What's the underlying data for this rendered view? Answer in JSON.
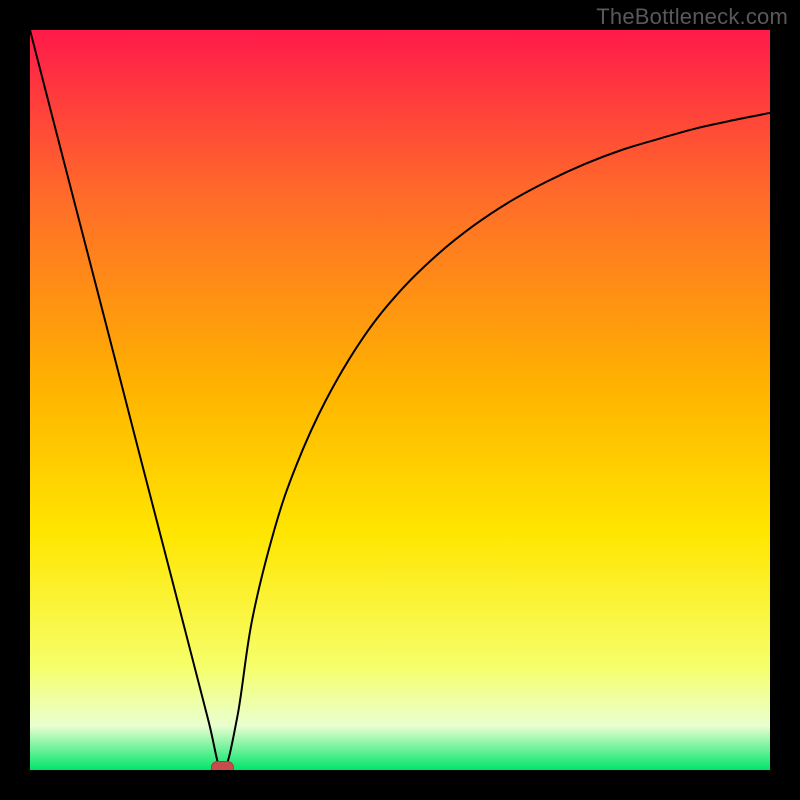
{
  "watermark": "TheBottleneck.com",
  "colors": {
    "frame": "#000000",
    "gradient_top": "#ff1a4a",
    "gradient_mid1": "#ff6a2a",
    "gradient_mid2": "#ffb200",
    "gradient_mid3": "#ffe600",
    "gradient_mid4": "#f6ff6a",
    "gradient_bottom_band": "#e9ffd0",
    "gradient_bottom": "#00e56a",
    "curve": "#000000",
    "marker_fill": "#c94c4c",
    "marker_stroke": "#a63c3c"
  },
  "chart_data": {
    "type": "line",
    "title": "",
    "xlabel": "",
    "ylabel": "",
    "xlim": [
      0,
      100
    ],
    "ylim": [
      0,
      100
    ],
    "grid": false,
    "legend": null,
    "series": [
      {
        "name": "curve",
        "x": [
          0,
          5,
          10,
          15,
          20,
          24,
          26,
          28,
          30,
          33,
          36,
          40,
          45,
          50,
          55,
          60,
          65,
          70,
          75,
          80,
          85,
          90,
          95,
          100
        ],
        "y": [
          100,
          80.6,
          61.3,
          41.9,
          22.6,
          7.1,
          0.0,
          7.1,
          20.2,
          32.4,
          41.2,
          50.0,
          58.4,
          64.7,
          69.6,
          73.6,
          76.9,
          79.6,
          81.9,
          83.8,
          85.3,
          86.7,
          87.8,
          88.8
        ]
      }
    ],
    "annotations": [
      {
        "name": "min-marker",
        "x": 26,
        "y": 0,
        "shape": "rounded-rect"
      }
    ],
    "background_gradient": {
      "direction": "top-to-bottom",
      "stops": [
        {
          "pos": 0.0,
          "color": "#ff1a4a"
        },
        {
          "pos": 0.22,
          "color": "#ff6a2a"
        },
        {
          "pos": 0.48,
          "color": "#ffb200"
        },
        {
          "pos": 0.68,
          "color": "#ffe600"
        },
        {
          "pos": 0.86,
          "color": "#f6ff6a"
        },
        {
          "pos": 0.94,
          "color": "#e9ffd0"
        },
        {
          "pos": 1.0,
          "color": "#00e56a"
        }
      ]
    }
  }
}
